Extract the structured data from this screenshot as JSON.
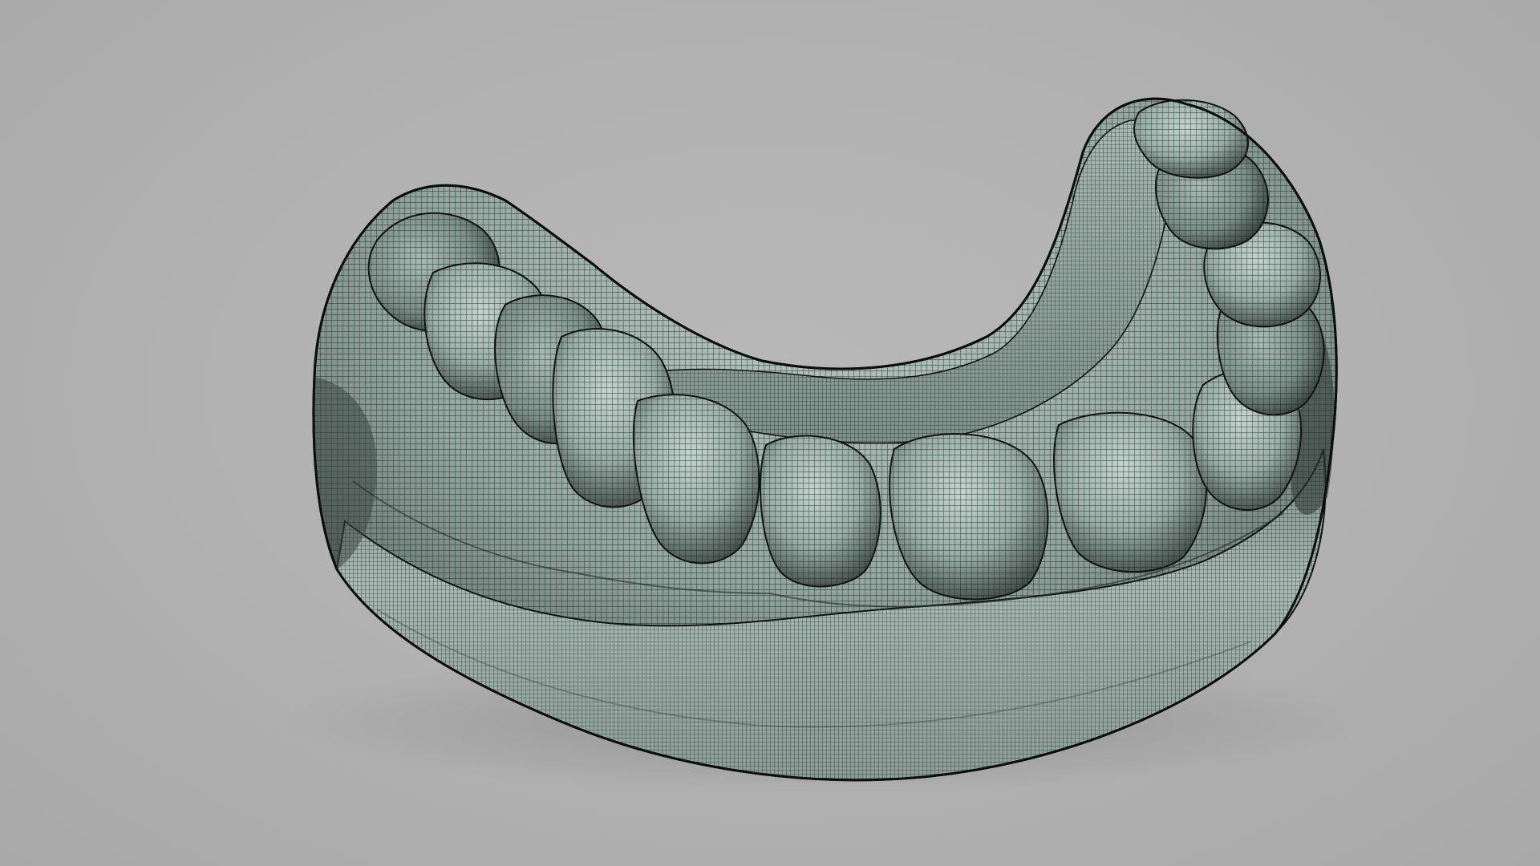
{
  "scene": {
    "subject": "",
    "render_style": "",
    "background_color": "#b1b1b1",
    "mesh_base_color": "#9fb2ab",
    "mesh_shadow_color": "#3f4a46",
    "wire_color": "#141a18"
  }
}
